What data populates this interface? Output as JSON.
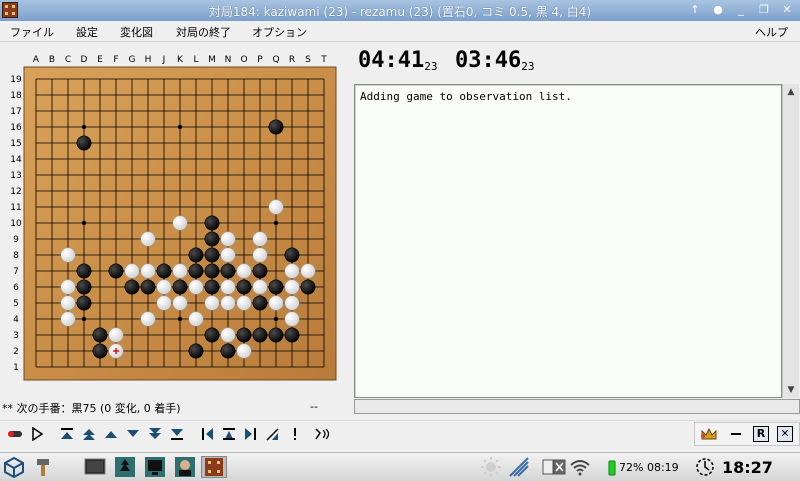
{
  "window": {
    "title": "対局184: kaziwami (23) - rezamu (23) (置石0, コミ 0.5, 黒 4, 白4)",
    "controls": [
      "↑",
      "●",
      "_",
      "❐",
      "✕"
    ]
  },
  "menu": [
    "ファイル",
    "設定",
    "変化図",
    "対局の終了",
    "オプション",
    "ヘルプ"
  ],
  "board": {
    "size": 19,
    "columns": [
      "A",
      "B",
      "C",
      "D",
      "E",
      "F",
      "G",
      "H",
      "J",
      "K",
      "L",
      "M",
      "N",
      "O",
      "P",
      "Q",
      "R",
      "S",
      "T"
    ],
    "rows": [
      "19",
      "18",
      "17",
      "16",
      "15",
      "14",
      "13",
      "12",
      "11",
      "10",
      "9",
      "8",
      "7",
      "6",
      "5",
      "4",
      "3",
      "2",
      "1"
    ],
    "black": [
      [
        3,
        15
      ],
      [
        15,
        16
      ],
      [
        11,
        10
      ],
      [
        11,
        9
      ],
      [
        10,
        8
      ],
      [
        16,
        8
      ],
      [
        11,
        8
      ],
      [
        3,
        7
      ],
      [
        5,
        7
      ],
      [
        8,
        7
      ],
      [
        10,
        7
      ],
      [
        11,
        7
      ],
      [
        12,
        7
      ],
      [
        14,
        7
      ],
      [
        6,
        6
      ],
      [
        7,
        6
      ],
      [
        3,
        6
      ],
      [
        9,
        6
      ],
      [
        11,
        6
      ],
      [
        13,
        6
      ],
      [
        15,
        6
      ],
      [
        17,
        6
      ],
      [
        3,
        5
      ],
      [
        14,
        5
      ],
      [
        16,
        5
      ],
      [
        4,
        3
      ],
      [
        11,
        3
      ],
      [
        13,
        3
      ],
      [
        14,
        3
      ],
      [
        15,
        3
      ],
      [
        16,
        3
      ],
      [
        4,
        2
      ],
      [
        10,
        2
      ],
      [
        12,
        2
      ]
    ],
    "white": [
      [
        15,
        11
      ],
      [
        9,
        10
      ],
      [
        7,
        9
      ],
      [
        12,
        9
      ],
      [
        14,
        9
      ],
      [
        2,
        8
      ],
      [
        12,
        8
      ],
      [
        14,
        8
      ],
      [
        6,
        7
      ],
      [
        7,
        7
      ],
      [
        9,
        7
      ],
      [
        13,
        7
      ],
      [
        16,
        7
      ],
      [
        17,
        7
      ],
      [
        2,
        6
      ],
      [
        8,
        6
      ],
      [
        10,
        6
      ],
      [
        12,
        6
      ],
      [
        14,
        6
      ],
      [
        16,
        6
      ],
      [
        2,
        5
      ],
      [
        8,
        5
      ],
      [
        9,
        5
      ],
      [
        11,
        5
      ],
      [
        12,
        5
      ],
      [
        13,
        5
      ],
      [
        15,
        5
      ],
      [
        16,
        5
      ],
      [
        2,
        4
      ],
      [
        7,
        4
      ],
      [
        10,
        4
      ],
      [
        16,
        4
      ],
      [
        5,
        3
      ],
      [
        12,
        3
      ],
      [
        5,
        2
      ],
      [
        13,
        2
      ]
    ],
    "last_move": [
      5,
      2
    ]
  },
  "clocks": {
    "black_time": "04:41",
    "black_count": "23",
    "white_time": "03:46",
    "white_count": "23"
  },
  "messages": {
    "text": "Adding game to observation list."
  },
  "status": {
    "text": "** 次の手番：黒75 (0 変化, 0 着手)",
    "right": "--"
  },
  "taskbar": {
    "battery": "72% 08:19",
    "clock": "18:27"
  }
}
